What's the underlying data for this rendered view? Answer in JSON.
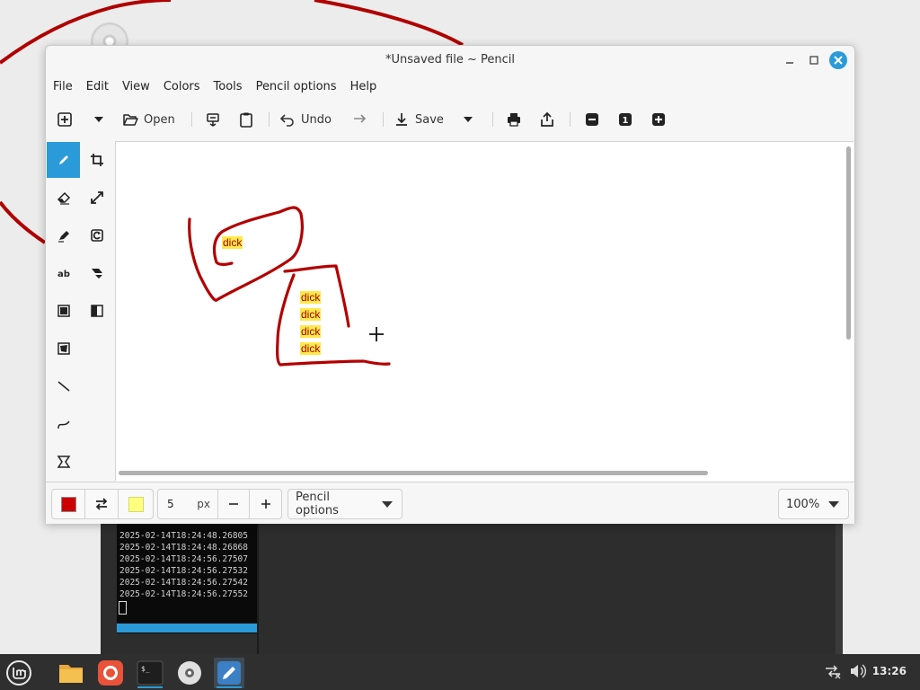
{
  "window": {
    "title": "*Unsaved file ~ Pencil"
  },
  "menu": [
    "File",
    "Edit",
    "View",
    "Colors",
    "Tools",
    "Pencil options",
    "Help"
  ],
  "toolbar": {
    "open_label": "Open",
    "undo_label": "Undo",
    "save_label": "Save",
    "zoom_reset_label": "1"
  },
  "tools": {
    "active": "pencil",
    "list": [
      "pencil",
      "crop",
      "eraser",
      "scale",
      "highlighter",
      "rotate",
      "text",
      "skew",
      "rectangle",
      "filters",
      "freeshape",
      "line",
      "curve",
      "selection"
    ]
  },
  "canvas": {
    "texts": [
      "dick",
      "dick",
      "dick",
      "dick",
      "dick"
    ],
    "stroke_color": "#b30000",
    "text_highlight": "#ffe94a"
  },
  "bottombar": {
    "main_color": "#cc0000",
    "secondary_color": "#ffff80",
    "size_value": "5",
    "size_unit": "px",
    "tool_options_label": "Pencil options",
    "zoom_label": "100%"
  },
  "terminal": {
    "lines": [
      "2025-02-14T18:24:48.26805",
      "2025-02-14T18:24:48.26868",
      "2025-02-14T18:24:56.27507",
      "2025-02-14T18:24:56.27532",
      "2025-02-14T18:24:56.27542",
      "2025-02-14T18:24:56.27552"
    ]
  },
  "taskbar": {
    "clock": "13:26",
    "apps": [
      "mint-menu-icon",
      "files-icon",
      "firefox-icon",
      "terminal-icon",
      "disc-icon",
      "pencil-app-icon"
    ]
  }
}
